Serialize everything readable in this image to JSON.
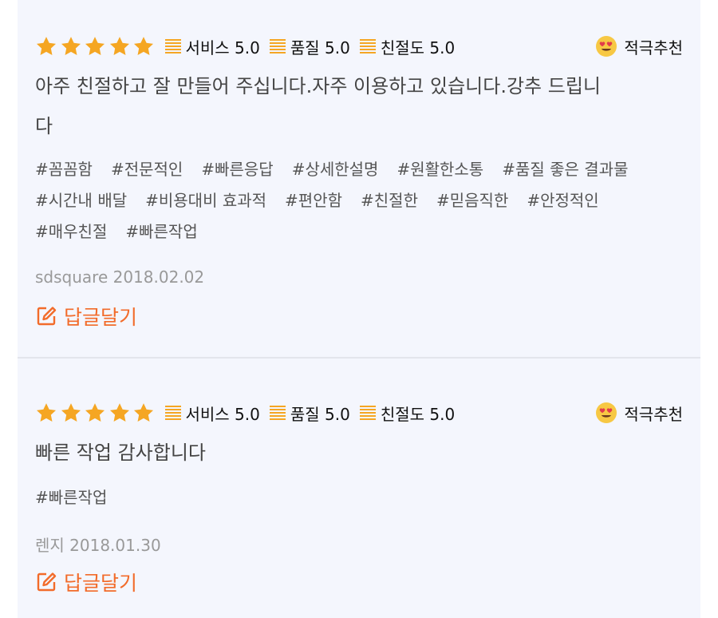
{
  "colors": {
    "accent": "#f26b2a",
    "star": "#f5a623",
    "background": "#f4f6fd"
  },
  "reviews": [
    {
      "stars": 5,
      "scores": [
        {
          "label": "서비스 5.0"
        },
        {
          "label": "품질 5.0"
        },
        {
          "label": "친절도 5.0"
        }
      ],
      "recommend": {
        "icon": "heart-eyes-emoji-icon",
        "label": "적극추천"
      },
      "body_line1": "아주 친절하고 잘 만들어 주십니다.자주 이용하고 있습니다.강추 드립니",
      "body_line2": "다",
      "tags": [
        "#꼼꼼함",
        "#전문적인",
        "#빠른응답",
        "#상세한설명",
        "#원활한소통",
        "#품질 좋은 결과물",
        "#시간내 배달",
        "#비용대비 효과적",
        "#편안함",
        "#친절한",
        "#믿음직한",
        "#안정적인",
        "#매우친절",
        "#빠른작업"
      ],
      "author_date": "sdsquare 2018.02.02",
      "reply_label": "답글달기"
    },
    {
      "stars": 5,
      "scores": [
        {
          "label": "서비스 5.0"
        },
        {
          "label": "품질 5.0"
        },
        {
          "label": "친절도 5.0"
        }
      ],
      "recommend": {
        "icon": "heart-eyes-emoji-icon",
        "label": "적극추천"
      },
      "body_line1": "빠른 작업 감사합니다",
      "tags": [
        "#빠른작업"
      ],
      "author_date": "렌지 2018.01.30",
      "reply_label": "답글달기"
    }
  ]
}
